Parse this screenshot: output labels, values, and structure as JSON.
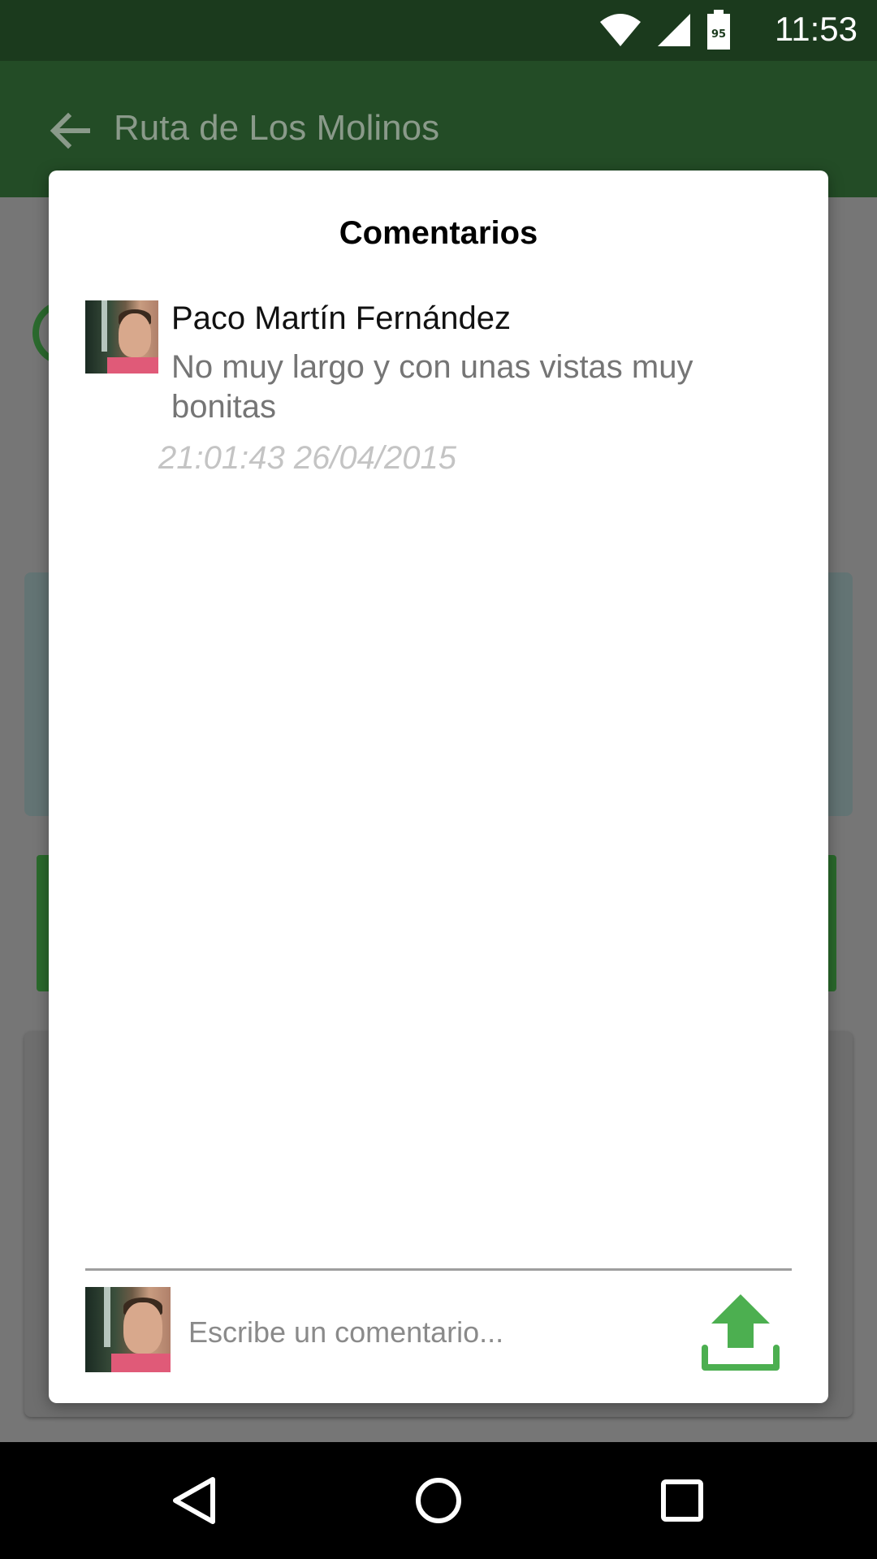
{
  "status_bar": {
    "time": "11:53",
    "battery_level": "95",
    "icons": [
      "wifi-icon",
      "signal-icon",
      "battery-icon"
    ]
  },
  "app_bar": {
    "title": "Ruta de Los Molinos",
    "back_icon": "arrow-back-icon"
  },
  "dialog": {
    "title": "Comentarios",
    "comments": [
      {
        "author": "Paco Martín Fernández",
        "text": "No muy largo y con unas vistas muy bonitas",
        "time": "21:01:43 26/04/2015"
      }
    ],
    "composer": {
      "placeholder": "Escribe un comentario...",
      "value": "",
      "send_icon": "upload-icon"
    }
  },
  "nav_bar": {
    "icons": [
      "back-triangle-icon",
      "home-circle-icon",
      "recents-square-icon"
    ]
  },
  "colors": {
    "status_bar": "#1b3a1d",
    "app_bar_dimmed": "#234c26",
    "accent_green": "#4caf50",
    "timestamp_gray": "#c4c4c4"
  }
}
